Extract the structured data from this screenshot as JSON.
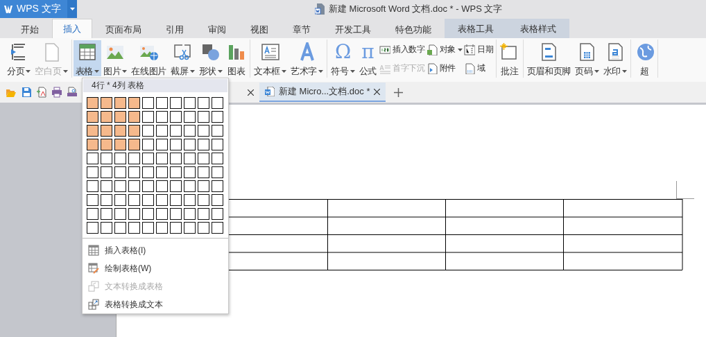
{
  "app_button": {
    "label": "WPS 文字"
  },
  "window": {
    "title": "新建 Microsoft Word 文档.doc * - WPS 文字"
  },
  "tabs": [
    {
      "label": "开始",
      "selected": false,
      "contextual": false
    },
    {
      "label": "插入",
      "selected": true,
      "contextual": false
    },
    {
      "label": "页面布局",
      "selected": false,
      "contextual": false
    },
    {
      "label": "引用",
      "selected": false,
      "contextual": false
    },
    {
      "label": "审阅",
      "selected": false,
      "contextual": false
    },
    {
      "label": "视图",
      "selected": false,
      "contextual": false
    },
    {
      "label": "章节",
      "selected": false,
      "contextual": false
    },
    {
      "label": "开发工具",
      "selected": false,
      "contextual": false
    },
    {
      "label": "特色功能",
      "selected": false,
      "contextual": false
    },
    {
      "label": "表格工具",
      "selected": false,
      "contextual": true
    },
    {
      "label": "表格样式",
      "selected": false,
      "contextual": true
    }
  ],
  "ribbon": {
    "groups": [
      {
        "items": [
          {
            "kind": "large",
            "label": "分页",
            "dropdown": true,
            "disabled": false,
            "pressed": false
          },
          {
            "kind": "large",
            "label": "空白页",
            "dropdown": true,
            "disabled": true,
            "pressed": false
          }
        ]
      },
      {
        "items": [
          {
            "kind": "large",
            "label": "表格",
            "dropdown": true,
            "disabled": false,
            "pressed": true
          },
          {
            "kind": "large",
            "label": "图片",
            "dropdown": true,
            "disabled": false,
            "pressed": false
          },
          {
            "kind": "large",
            "label": "在线图片",
            "dropdown": false,
            "disabled": false,
            "pressed": false
          },
          {
            "kind": "large",
            "label": "截屏",
            "dropdown": true,
            "disabled": false,
            "pressed": false
          },
          {
            "kind": "large",
            "label": "形状",
            "dropdown": true,
            "disabled": false,
            "pressed": false
          },
          {
            "kind": "large",
            "label": "图表",
            "dropdown": false,
            "disabled": false,
            "pressed": false
          }
        ]
      },
      {
        "items": [
          {
            "kind": "large",
            "label": "文本框",
            "dropdown": true,
            "disabled": false,
            "pressed": false
          },
          {
            "kind": "large",
            "label": "艺术字",
            "dropdown": true,
            "disabled": false,
            "pressed": false
          }
        ]
      },
      {
        "items": [
          {
            "kind": "symbol",
            "symbol": "Ω",
            "label": "符号",
            "dropdown": true,
            "disabled": false,
            "pressed": false
          },
          {
            "kind": "symbol",
            "symbol": "π",
            "label": "公式",
            "dropdown": false,
            "disabled": false,
            "pressed": false
          },
          {
            "kind": "stack",
            "items": [
              {
                "label": "插入数字",
                "dropdown": false,
                "disabled": false
              },
              {
                "label": "首字下沉",
                "dropdown": false,
                "disabled": true
              }
            ]
          },
          {
            "kind": "stack",
            "items": [
              {
                "label": "对象",
                "dropdown": true,
                "disabled": false
              },
              {
                "label": "附件",
                "dropdown": false,
                "disabled": false
              }
            ]
          },
          {
            "kind": "stack",
            "items": [
              {
                "label": "日期",
                "dropdown": false,
                "disabled": false
              },
              {
                "label": "域",
                "dropdown": false,
                "disabled": false
              }
            ]
          }
        ]
      },
      {
        "items": [
          {
            "kind": "large",
            "label": "批注",
            "dropdown": false,
            "disabled": false,
            "pressed": false
          }
        ]
      },
      {
        "items": [
          {
            "kind": "large",
            "label": "页眉和页脚",
            "dropdown": false,
            "disabled": false,
            "pressed": false
          },
          {
            "kind": "large",
            "label": "页码",
            "dropdown": true,
            "disabled": false,
            "pressed": false
          },
          {
            "kind": "large",
            "label": "水印",
            "dropdown": true,
            "disabled": false,
            "pressed": false
          }
        ]
      },
      {
        "items": [
          {
            "kind": "large",
            "label": "超",
            "dropdown": false,
            "disabled": false,
            "pressed": false
          }
        ]
      }
    ]
  },
  "document_tabs": [
    {
      "label": "新建 Micro...文档.doc *",
      "selected": true
    }
  ],
  "table_menu": {
    "header": "4行 * 4列 表格",
    "grid": [
      [
        {
          "selected": true
        },
        {
          "selected": true
        },
        {
          "selected": true
        },
        {
          "selected": true
        },
        {
          "selected": false
        },
        {
          "selected": false
        },
        {
          "selected": false
        },
        {
          "selected": false
        },
        {
          "selected": false
        },
        {
          "selected": false
        }
      ],
      [
        {
          "selected": true
        },
        {
          "selected": true
        },
        {
          "selected": true
        },
        {
          "selected": true
        },
        {
          "selected": false
        },
        {
          "selected": false
        },
        {
          "selected": false
        },
        {
          "selected": false
        },
        {
          "selected": false
        },
        {
          "selected": false
        }
      ],
      [
        {
          "selected": true
        },
        {
          "selected": true
        },
        {
          "selected": true
        },
        {
          "selected": true
        },
        {
          "selected": false
        },
        {
          "selected": false
        },
        {
          "selected": false
        },
        {
          "selected": false
        },
        {
          "selected": false
        },
        {
          "selected": false
        }
      ],
      [
        {
          "selected": true
        },
        {
          "selected": true
        },
        {
          "selected": true
        },
        {
          "selected": true
        },
        {
          "selected": false
        },
        {
          "selected": false
        },
        {
          "selected": false
        },
        {
          "selected": false
        },
        {
          "selected": false
        },
        {
          "selected": false
        }
      ],
      [
        {
          "selected": false
        },
        {
          "selected": false
        },
        {
          "selected": false
        },
        {
          "selected": false
        },
        {
          "selected": false
        },
        {
          "selected": false
        },
        {
          "selected": false
        },
        {
          "selected": false
        },
        {
          "selected": false
        },
        {
          "selected": false
        }
      ],
      [
        {
          "selected": false
        },
        {
          "selected": false
        },
        {
          "selected": false
        },
        {
          "selected": false
        },
        {
          "selected": false
        },
        {
          "selected": false
        },
        {
          "selected": false
        },
        {
          "selected": false
        },
        {
          "selected": false
        },
        {
          "selected": false
        }
      ],
      [
        {
          "selected": false
        },
        {
          "selected": false
        },
        {
          "selected": false
        },
        {
          "selected": false
        },
        {
          "selected": false
        },
        {
          "selected": false
        },
        {
          "selected": false
        },
        {
          "selected": false
        },
        {
          "selected": false
        },
        {
          "selected": false
        }
      ],
      [
        {
          "selected": false
        },
        {
          "selected": false
        },
        {
          "selected": false
        },
        {
          "selected": false
        },
        {
          "selected": false
        },
        {
          "selected": false
        },
        {
          "selected": false
        },
        {
          "selected": false
        },
        {
          "selected": false
        },
        {
          "selected": false
        }
      ],
      [
        {
          "selected": false
        },
        {
          "selected": false
        },
        {
          "selected": false
        },
        {
          "selected": false
        },
        {
          "selected": false
        },
        {
          "selected": false
        },
        {
          "selected": false
        },
        {
          "selected": false
        },
        {
          "selected": false
        },
        {
          "selected": false
        }
      ],
      [
        {
          "selected": false
        },
        {
          "selected": false
        },
        {
          "selected": false
        },
        {
          "selected": false
        },
        {
          "selected": false
        },
        {
          "selected": false
        },
        {
          "selected": false
        },
        {
          "selected": false
        },
        {
          "selected": false
        },
        {
          "selected": false
        }
      ]
    ],
    "items": [
      {
        "label": "插入表格(I)",
        "disabled": false
      },
      {
        "label": "绘制表格(W)",
        "disabled": false
      },
      {
        "label": "文本转换成表格",
        "disabled": true
      },
      {
        "label": "表格转换成文本",
        "disabled": false
      }
    ]
  }
}
